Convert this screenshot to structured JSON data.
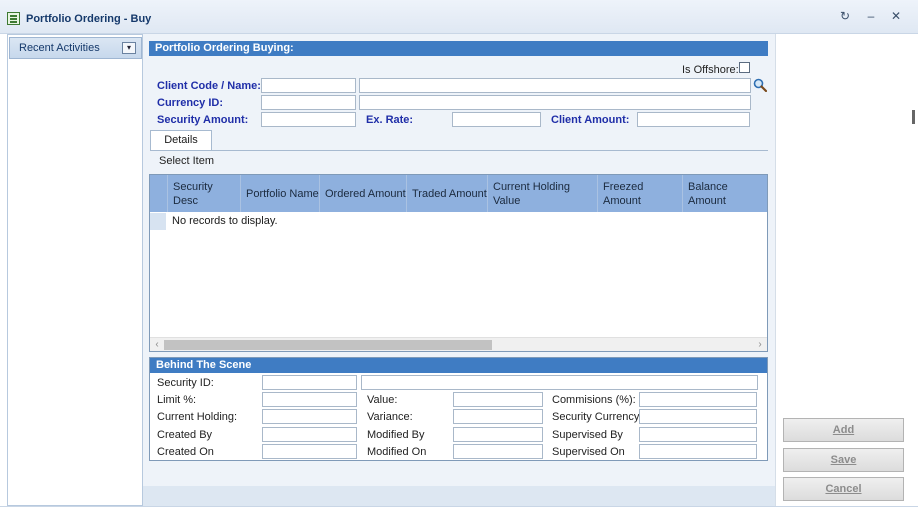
{
  "window": {
    "title": "Portfolio Ordering - Buy",
    "refresh_glyph": "↻",
    "minimize_glyph": "–",
    "close_glyph": "✕"
  },
  "sidebar": {
    "recent_label": "Recent Activities",
    "dropdown_glyph": "▾"
  },
  "form": {
    "header": "Portfolio Ordering Buying:",
    "is_offshore_label": "Is Offshore:",
    "client_code_label": "Client Code / Name:",
    "client_code_value": "",
    "client_name_value": "",
    "currency_id_label": "Currency ID:",
    "currency_id_value": "",
    "currency_name_value": "",
    "security_amount_label": "Security Amount:",
    "security_amount_value": "",
    "ex_rate_label": "Ex. Rate:",
    "ex_rate_value": "",
    "client_amount_label": "Client Amount:",
    "client_amount_value": ""
  },
  "tabs": [
    {
      "label": "Details"
    }
  ],
  "details": {
    "select_item_label": "Select Item",
    "columns": [
      "Security Desc",
      "Portfolio Name",
      "Ordered Amount",
      "Traded Amount",
      "Current Holding Value",
      "Freezed Amount",
      "Balance Amount"
    ],
    "no_records": "No records to display.",
    "scroll_left": "‹",
    "scroll_right": "›"
  },
  "behind": {
    "header": "Behind The Scene",
    "security_id_label": "Security ID:",
    "limit_label": "Limit %:",
    "value_label": "Value:",
    "commissions_label": "Commisions (%):",
    "current_holding_label": "Current Holding:",
    "variance_label": "Variance:",
    "security_currency_label": "Security Currency:",
    "created_by_label": "Created By",
    "modified_by_label": "Modified By",
    "supervised_by_label": "Supervised By",
    "created_on_label": "Created On",
    "modified_on_label": "Modified On",
    "supervised_on_label": "Supervised On"
  },
  "actions": {
    "add_label": "Add",
    "save_label": "Save",
    "cancel_label": "Cancel"
  },
  "colors": {
    "header_blue": "#3f7cc3",
    "field_label_blue": "#1f2ea8",
    "grid_header": "#8eb0de"
  },
  "icons": {
    "search": "magnifier-icon",
    "app": "form-icon"
  }
}
